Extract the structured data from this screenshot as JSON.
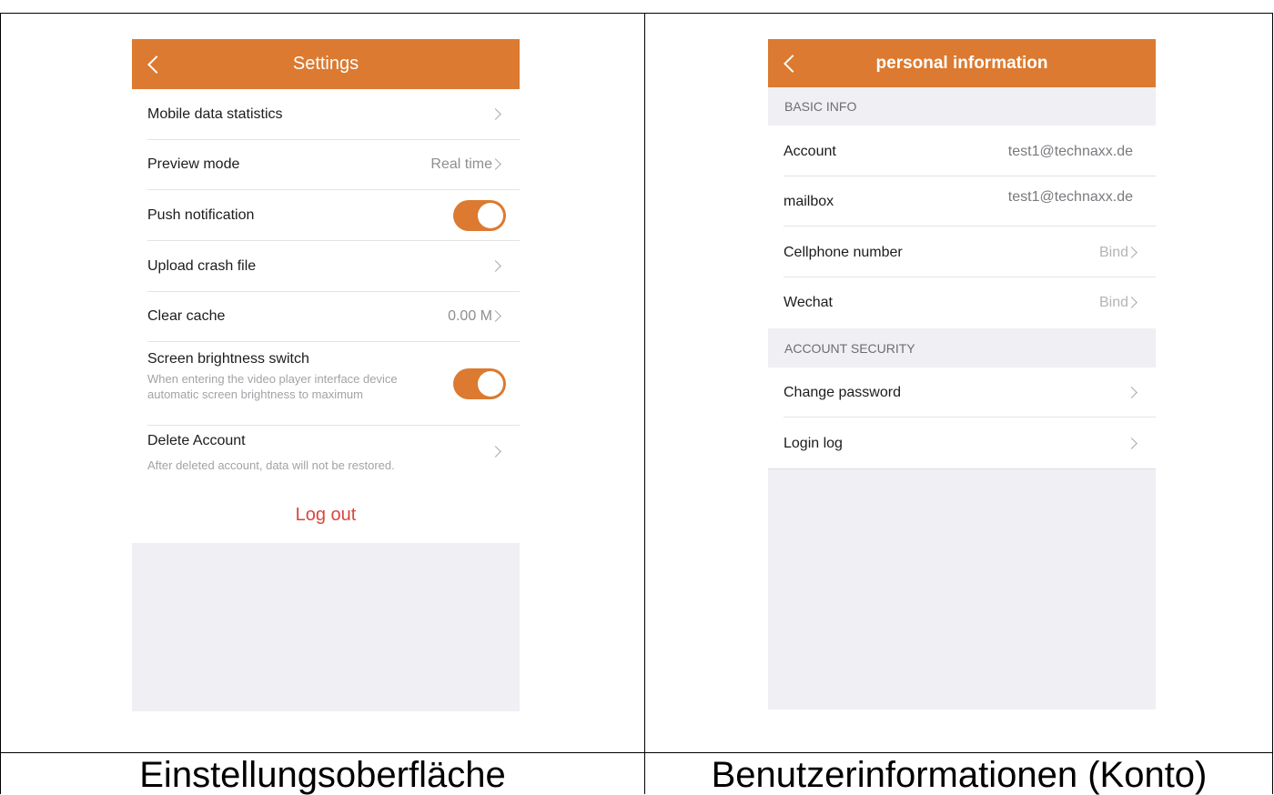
{
  "captions": {
    "left": "Einstellungsoberfläche",
    "right": "Benutzerinformationen (Konto)"
  },
  "colors": {
    "accent": "#db7a30",
    "logout": "#d9463d",
    "background": "#efeff4"
  },
  "settings": {
    "title": "Settings",
    "back_icon": "chevron-left-icon",
    "items": [
      {
        "label": "Mobile data statistics"
      },
      {
        "label": "Preview mode",
        "value": "Real time"
      },
      {
        "label": "Push notification",
        "toggle": true
      },
      {
        "label": "Upload crash file"
      },
      {
        "label": "Clear cache",
        "value": "0.00 M"
      },
      {
        "label": "Screen brightness switch",
        "sub": "When entering the video player interface device automatic screen brightness to maximum",
        "toggle": true
      },
      {
        "label": "Delete Account",
        "sub": "After deleted account, data will not be restored."
      }
    ],
    "logout": "Log out"
  },
  "personal": {
    "title": "personal information",
    "back_icon": "chevron-left-icon",
    "basic_header": "BASIC INFO",
    "basic_items": [
      {
        "label": "Account",
        "value": "test1@technaxx.de"
      },
      {
        "label": "mailbox",
        "value": "test1@technaxx.de"
      },
      {
        "label": "Cellphone number",
        "value": "Bind"
      },
      {
        "label": "Wechat",
        "value": "Bind"
      }
    ],
    "security_header": "ACCOUNT SECURITY",
    "security_items": [
      {
        "label": "Change password"
      },
      {
        "label": "Login log"
      }
    ]
  }
}
